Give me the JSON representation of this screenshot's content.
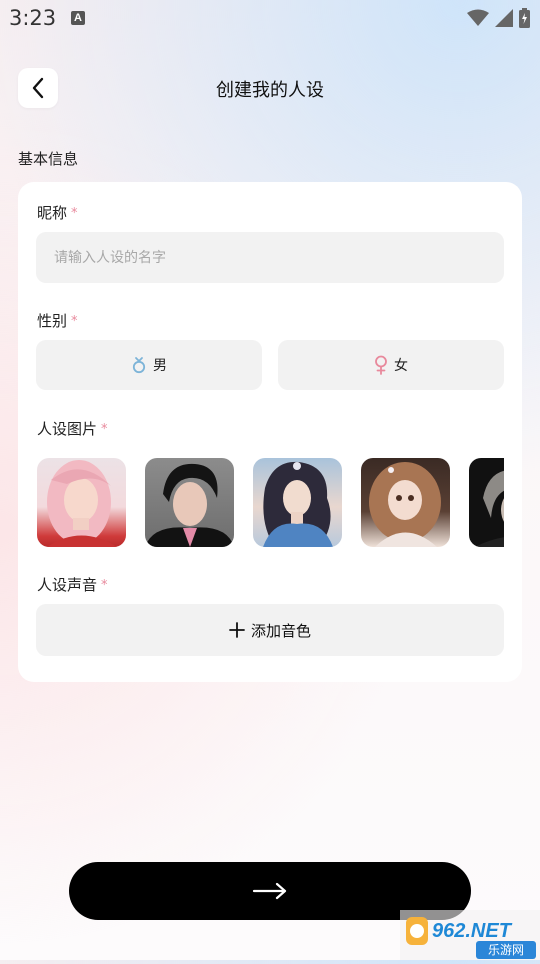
{
  "status_bar": {
    "time": "3:23",
    "notification_icon": "A"
  },
  "header": {
    "back_icon": "chevron-left-icon",
    "title": "创建我的人设"
  },
  "section": {
    "title": "基本信息"
  },
  "form": {
    "nickname": {
      "label": "昵称",
      "required_mark": "*",
      "placeholder": "请输入人设的名字",
      "value": ""
    },
    "gender": {
      "label": "性别",
      "required_mark": "*",
      "options": [
        {
          "label": "男",
          "icon": "male-icon"
        },
        {
          "label": "女",
          "icon": "female-icon"
        }
      ]
    },
    "images": {
      "label": "人设图片",
      "required_mark": "*",
      "avatars": [
        "pink-hair-girl",
        "dark-hair-boy",
        "blue-dress-girl",
        "curly-hair-girl",
        "dark-portrait"
      ]
    },
    "voice": {
      "label": "人设声音",
      "required_mark": "*",
      "button_label": "添加音色"
    }
  },
  "footer": {
    "next_icon": "arrow-right-icon"
  },
  "watermark": {
    "text": "962.NET",
    "subtext": "乐游网"
  },
  "colors": {
    "required": "#e8899c",
    "male": "#7db4d8",
    "female": "#e8899c",
    "input_bg": "#f2f2f2",
    "button": "#000000"
  }
}
